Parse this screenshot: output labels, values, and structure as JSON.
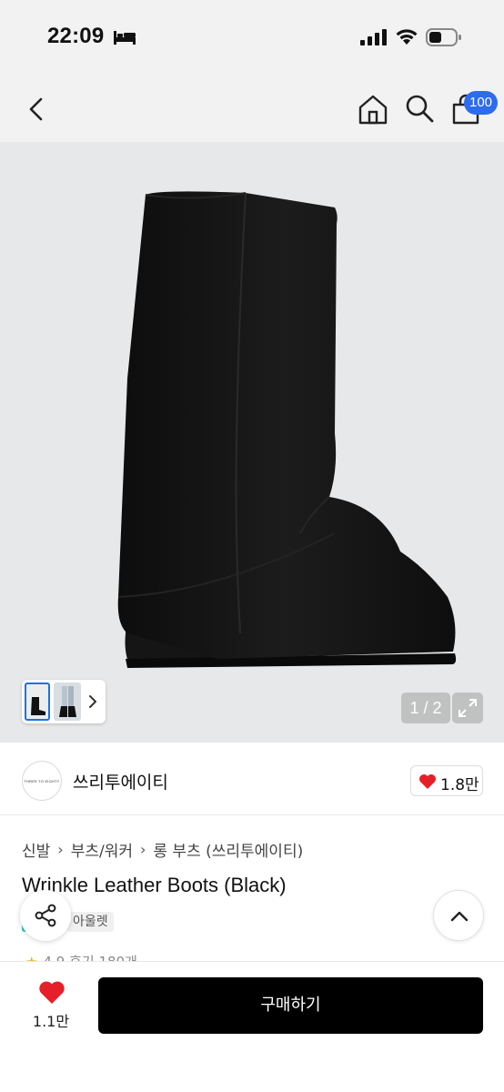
{
  "status_bar": {
    "time": "22:09",
    "icons": [
      "bed-icon",
      "signal-icon",
      "wifi-icon",
      "battery-icon"
    ]
  },
  "nav": {
    "icons": [
      "back-icon",
      "home-icon",
      "search-icon",
      "cart-icon"
    ],
    "cart_badge": "100",
    "badge_color": "#2d6bf0"
  },
  "gallery": {
    "counter": "1 / 2",
    "current": 1,
    "total": 2,
    "icons": [
      "chevron-right-icon",
      "expand-icon"
    ]
  },
  "brand": {
    "logo_text": "THREE TO EIGHTY",
    "name": "쓰리투에이티",
    "like_count": "1.8만",
    "like_color": "#e5202a"
  },
  "breadcrumb": [
    "신발",
    "부츠/워커",
    "롱 부츠 (쓰리투에이티)"
  ],
  "product": {
    "title": "Wrinkle Leather Boots (Black)",
    "tag_outlet": "아울렛",
    "rating_partial": "4.9 후기 180개"
  },
  "bottom_bar": {
    "wish_count": "1.1만",
    "buy_label": "구매하기"
  }
}
